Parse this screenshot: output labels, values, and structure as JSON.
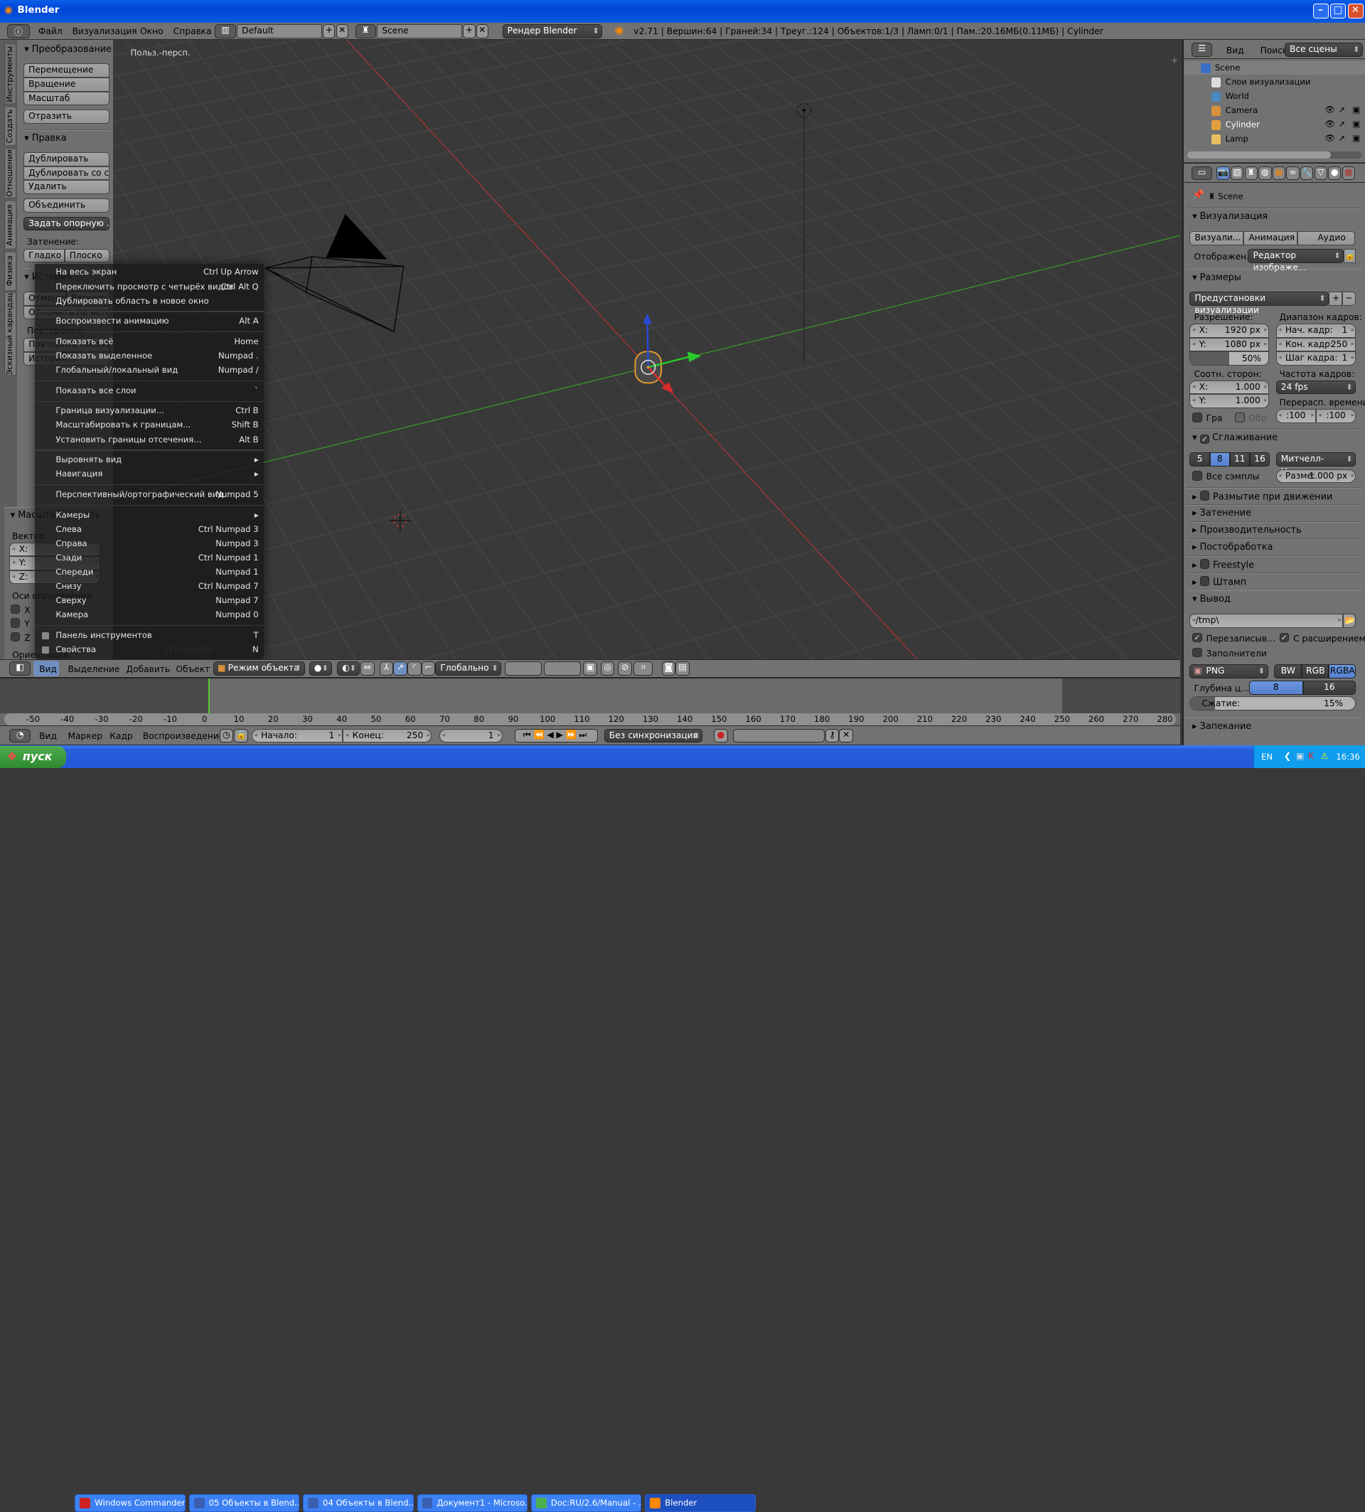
{
  "window": {
    "title": "Blender"
  },
  "top_header": {
    "menus": [
      "Файл",
      "Визуализация",
      "Окно",
      "Справка"
    ],
    "layout": "Default",
    "scene": "Scene",
    "engine": "Рендер Blender",
    "stats": "v2.71 | Вершин:64 | Граней:34 | Треуг.:124 | Объектов:1/3 | Ламп:0/1 | Пам.:20.16МБ(0.11МБ) | Cylinder"
  },
  "tool_tabs": [
    "Инструменты",
    "Создать",
    "Отношения",
    "Анимация",
    "Физика",
    "Эскизный карандаш"
  ],
  "tool_shelf": {
    "transform": {
      "title": "Преобразование",
      "buttons": [
        "Перемещение",
        "Вращение",
        "Масштаб"
      ],
      "mirror": "Отразить"
    },
    "edit": {
      "title": "Правка",
      "buttons": [
        "Дублировать",
        "Дублировать со св...",
        "Удалить"
      ],
      "join": "Объединить",
      "set_origin": "Задать опорную ...",
      "shading_label": "Затенение:",
      "smooth": "Гладко",
      "flat": "Плоско"
    },
    "history": {
      "title": "История",
      "undo": "Отменить",
      "redo": "Вернуть",
      "undo_history": "Отменить по исто...",
      "repeat_label": "Повторение:",
      "repeat_last": "Повторить последн...",
      "history_btn": "История..."
    }
  },
  "operator_panel": {
    "title": "Масштабировать",
    "vector_label": "Вектор",
    "x": "X:",
    "y": "Y:",
    "z": "Z:",
    "constraint_label": "Оси ограничения",
    "cx": "X",
    "cy": "Y",
    "cz": "Z",
    "orientation_label": "Ориентация"
  },
  "viewport": {
    "view_name": "Польз.-персп.",
    "object_label": "(1) Cylinder",
    "colors": {
      "x_axis": "#b03535",
      "y_axis": "#3a9a2a",
      "grid": "#474747",
      "bg": "#393939",
      "selected": "#f0a030"
    }
  },
  "view_menu": {
    "items": [
      {
        "label": "На весь экран",
        "shortcut": "Ctrl Up Arrow"
      },
      {
        "label": "Переключить просмотр с четырёх видов",
        "shortcut": "Ctrl Alt Q"
      },
      {
        "label": "Дублировать область в новое окно",
        "shortcut": ""
      },
      {
        "sep": true,
        "label": "Воспроизвести анимацию",
        "shortcut": "Alt A"
      },
      {
        "sep": true,
        "label": "Показать всё",
        "shortcut": "Home"
      },
      {
        "label": "Показать выделенное",
        "shortcut": "Numpad ."
      },
      {
        "label": "Глобальный/локальный вид",
        "shortcut": "Numpad /"
      },
      {
        "sep": true,
        "label": "Показать все слои",
        "shortcut": "`"
      },
      {
        "sep": true,
        "label": "Граница визуализации...",
        "shortcut": "Ctrl B"
      },
      {
        "label": "Масштабировать к границам...",
        "shortcut": "Shift B"
      },
      {
        "label": "Установить границы отсечения...",
        "shortcut": "Alt B"
      },
      {
        "sep": true,
        "label": "Выровнять вид",
        "shortcut": "▸"
      },
      {
        "label": "Навигация",
        "shortcut": "▸"
      },
      {
        "sep": true,
        "label": "Перспективный/ортографический вид",
        "shortcut": "Numpad 5"
      },
      {
        "sep": true,
        "label": "Камеры",
        "shortcut": "▸"
      },
      {
        "label": "Слева",
        "shortcut": "Ctrl Numpad 3"
      },
      {
        "label": "Справа",
        "shortcut": "Numpad 3"
      },
      {
        "label": "Сзади",
        "shortcut": "Ctrl Numpad 1"
      },
      {
        "label": "Спереди",
        "shortcut": "Numpad 1"
      },
      {
        "label": "Снизу",
        "shortcut": "Ctrl Numpad 7"
      },
      {
        "label": "Сверху",
        "shortcut": "Numpad 7"
      },
      {
        "label": "Камера",
        "shortcut": "Numpad 0"
      },
      {
        "sep": true,
        "check": true,
        "label": "Панель инструментов",
        "shortcut": "T"
      },
      {
        "check": true,
        "label": "Свойства",
        "shortcut": "N"
      }
    ]
  },
  "view3d_header": {
    "menus": [
      "Вид",
      "Выделение",
      "Добавить",
      "Объект"
    ],
    "mode": "Режим объекта",
    "orientation": "Глобально"
  },
  "timeline": {
    "ticks": [
      -50,
      -40,
      -30,
      -20,
      -10,
      0,
      10,
      20,
      30,
      40,
      50,
      60,
      70,
      80,
      90,
      100,
      110,
      120,
      130,
      140,
      150,
      160,
      170,
      180,
      190,
      200,
      210,
      220,
      230,
      240,
      250,
      260,
      270,
      280
    ],
    "current_frame": 1,
    "start": 1,
    "end": 250,
    "menus": [
      "Вид",
      "Маркер",
      "Кадр",
      "Воспроизведение"
    ],
    "start_label": "Начало:",
    "start_value": "1",
    "end_label": "Конец:",
    "end_value": "250",
    "frame_value": "1",
    "sync": "Без синхронизации"
  },
  "outliner": {
    "menus": [
      "Вид",
      "Поиск"
    ],
    "filter": "Все сцены",
    "items": [
      {
        "label": "Scene",
        "icon": "scene-icon"
      },
      {
        "label": "Слои визуализации",
        "icon": "render-layers-icon"
      },
      {
        "label": "World",
        "icon": "world-icon"
      },
      {
        "label": "Camera",
        "icon": "camera-icon"
      },
      {
        "label": "Cylinder",
        "icon": "mesh-icon",
        "selected": true
      },
      {
        "label": "Lamp",
        "icon": "lamp-icon"
      }
    ]
  },
  "properties": {
    "context": "Scene",
    "render": {
      "title": "Визуализация",
      "render_btn": "Визуали...",
      "anim_btn": "Анимация",
      "audio_btn": "Аудио",
      "display_label": "Отображен...",
      "display_value": "Редактор изображе..."
    },
    "dimensions": {
      "title": "Размеры",
      "presets": "Предустановки визуализации",
      "resolution_label": "Разрешение:",
      "res_x_k": "X:",
      "res_x": "1920 px",
      "res_y_k": "Y:",
      "res_y": "1080 px",
      "res_pct": "50%",
      "res_pct_value": 50,
      "range_label": "Диапазон кадров:",
      "start_k": "Нач. кадр:",
      "start": "1",
      "end_k": "Кон. кадр:",
      "end": "250",
      "step_k": "Шаг кадра:",
      "step": "1",
      "aspect_label": "Соотн. сторон:",
      "asp_x_k": "X:",
      "asp_x": "1.000",
      "asp_y_k": "Y:",
      "asp_y": "1.000",
      "fps_label": "Частота кадров:",
      "fps": "24 fps",
      "remap_label": "Перерасп. времени:",
      "remap_old": ":100",
      "remap_new": ":100",
      "border": "Гра",
      "crop": "Обр"
    },
    "aa": {
      "title": "Сглаживание",
      "samples": [
        "5",
        "8",
        "11",
        "16"
      ],
      "selected": "8",
      "filter": "Митчелл-Нетра...",
      "full_sample": "Все сэмплы",
      "size_k": "Разме:",
      "size": "1.000 px"
    },
    "collapsed": [
      "Размытие при движении",
      "Затенение",
      "Производительность",
      "Постобработка",
      "Freestyle",
      "Штамп"
    ],
    "output": {
      "title": "Вывод",
      "path": "/tmp\\",
      "overwrite": "Перезаписыв...",
      "extension": "С расширением",
      "placeholders": "Заполнители",
      "format": "PNG",
      "bw": "BW",
      "rgb": "RGB",
      "rgba": "RGBA",
      "depth_label": "Глубина ц...",
      "depth8": "8",
      "depth16": "16",
      "compression_k": "Сжатие:",
      "compression": "15%",
      "compression_value": 15
    },
    "bake": "Запекание"
  },
  "taskbar": {
    "start": "пуск",
    "tasks": [
      "Windows Commander...",
      "05 Объекты в Blend...",
      "04 Объекты в Blend...",
      "Документ1 - Microso...",
      "Doc:RU/2.6/Manual - ...",
      "Blender"
    ],
    "lang": "EN",
    "clock": "16:36"
  }
}
